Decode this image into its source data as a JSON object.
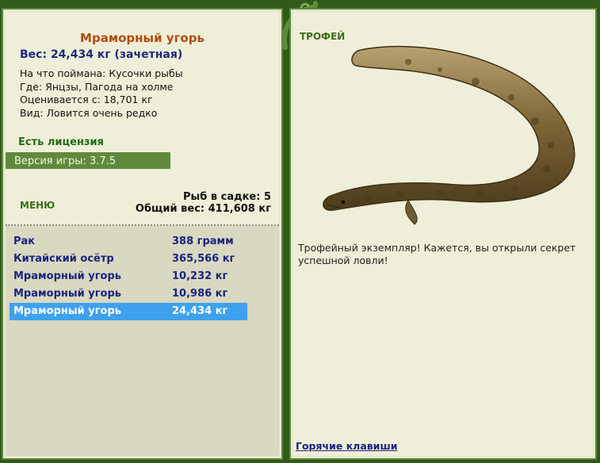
{
  "fish_info": {
    "title": "Мраморный угорь",
    "weight": "Вес: 24,434 кг (зачетная)",
    "bait": "На что поймана: Кусочки рыбы",
    "location": "Где: Янцзы, Пагода на холме",
    "value": "Оценивается с: 18,701 кг",
    "rarity": "Вид: Ловится очень редко"
  },
  "license": "Есть лицензия",
  "version": "Версия игры: 3.7.5",
  "menu_label": "МЕНЮ",
  "catch_summary": {
    "count": "Рыб в садке: 5",
    "total": "Общий вес: 411,608 кг"
  },
  "catch_list": [
    {
      "name": "Рак",
      "weight": "388 грамм"
    },
    {
      "name": "Китайский осётр",
      "weight": "365,566 кг"
    },
    {
      "name": "Мраморный угорь",
      "weight": "10,232 кг"
    },
    {
      "name": "Мраморный угорь",
      "weight": "10,986 кг"
    },
    {
      "name": "Мраморный угорь",
      "weight": "24,434 кг",
      "selected": true
    }
  ],
  "right_panel": {
    "header": "ТРОФЕЙ",
    "trophy_text": "Трофейный экземпляр! Кажется, вы открыли секрет успешной ловли!",
    "hotkeys": "Горячие клавиши"
  },
  "colors": {
    "background": "#2f5a1a",
    "panel": "#efefd9",
    "accent_green": "#5f8a3c",
    "title_orange": "#b34a0e",
    "text_navy": "#1a237e",
    "selection_blue": "#3ea1ee"
  }
}
